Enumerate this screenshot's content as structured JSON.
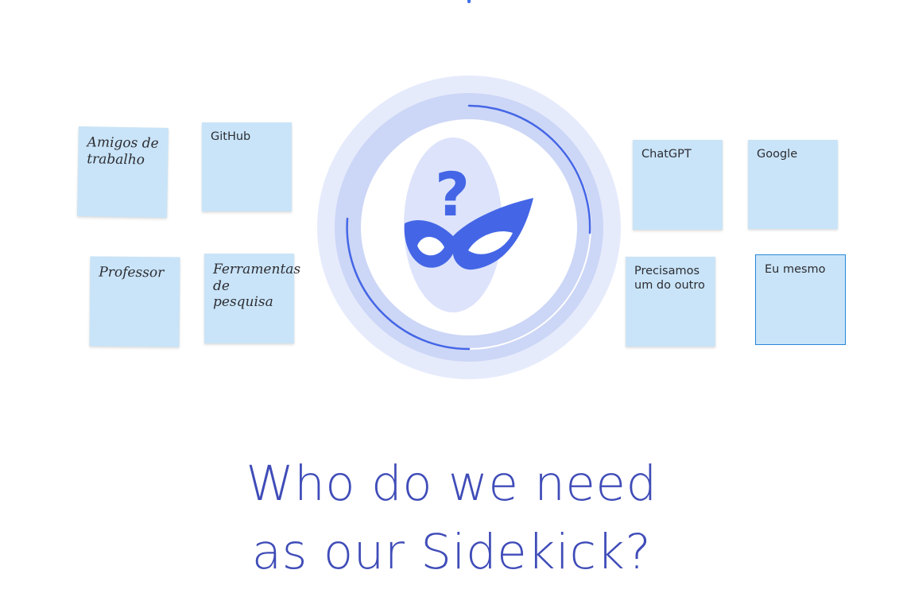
{
  "notes_left": [
    {
      "text": "Amigos de\ntrabalho",
      "style": "script",
      "rotation_deg": 1
    },
    {
      "text": "GitHub",
      "style": "hand",
      "rotation_deg": 0
    },
    {
      "text": "Professor",
      "style": "script",
      "rotation_deg": 0.5
    },
    {
      "text": "Ferramentas\nde pesquisa",
      "style": "script",
      "rotation_deg": 0
    }
  ],
  "notes_right": [
    {
      "text": "ChatGPT",
      "style": "hand",
      "rotation_deg": 0
    },
    {
      "text": "Google",
      "style": "hand",
      "rotation_deg": 0
    },
    {
      "text": "Precisamos\num do outro",
      "style": "hand",
      "rotation_deg": 0
    },
    {
      "text": "Eu mesmo",
      "style": "hand",
      "rotation_deg": 0,
      "selected": true
    }
  ],
  "center_graphic": {
    "icon": "masked-head-question-icon",
    "glyph": "?",
    "colors": {
      "outer_ring": "#e6ebfc",
      "mid_ring": "#ccd6f6",
      "inner_disc": "#ffffff",
      "arc": "#4466e6",
      "head": "#dde3fb",
      "mask": "#4466e6"
    }
  },
  "title": {
    "line1": "Who do we need",
    "line2": "as our Sidekick?"
  },
  "colors": {
    "note_bg": "#c9e4f8",
    "note_selected_border": "#2a86d9",
    "title": "#3f4cb8"
  }
}
